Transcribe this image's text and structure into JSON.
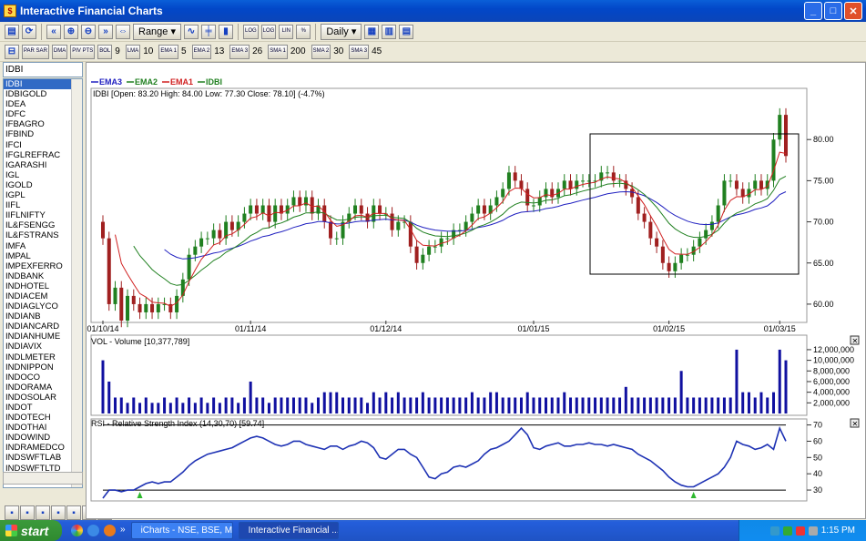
{
  "window": {
    "title": "Interactive Financial Charts",
    "min": "_",
    "max": "□",
    "close": "✕"
  },
  "toolbar1": {
    "range_label": "Range",
    "period_label": "Daily",
    "log1": "LOG",
    "log2": "LOG",
    "lin": "LIN",
    "pct": "%"
  },
  "toolbar2": {
    "par_sar": "PAR SAR",
    "dma": "DMA",
    "piv_pts": "PIV PTS",
    "bol": "BOL",
    "bol_val": "9",
    "lma": "LMA",
    "lma_val": "10",
    "ema1": "EMA 1",
    "ema1_val": "5",
    "ema2": "EMA 2",
    "ema2_val": "13",
    "ema3": "EMA 3",
    "ema3_val": "26",
    "sma1": "SMA 1",
    "sma1_val": "200",
    "sma2": "SMA 2",
    "sma2_val": "30",
    "sma3": "SMA 3",
    "sma3_val": "45"
  },
  "symbol_input": "IDBI",
  "symbols": [
    "IDBI",
    "IDBIGOLD",
    "IDEA",
    "IDFC",
    "IFBAGRO",
    "IFBIND",
    "IFCI",
    "IFGLREFRAC",
    "IGARASHI",
    "IGL",
    "IGOLD",
    "IGPL",
    "IIFL",
    "IIFLNIFTY",
    "IL&FSENGG",
    "IL&FSTRANS",
    "IMFA",
    "IMPAL",
    "IMPEXFERRO",
    "INDBANK",
    "INDHOTEL",
    "INDIACEM",
    "INDIAGLYCO",
    "INDIANB",
    "INDIANCARD",
    "INDIANHUME",
    "INDIAVIX",
    "INDLMETER",
    "INDNIPPON",
    "INDOCO",
    "INDORAMA",
    "INDOSOLAR",
    "INDOT",
    "INDOTECH",
    "INDOTHAI",
    "INDOWIND",
    "INDRAMEDCO",
    "INDSWFTLAB",
    "INDSWFTLTD"
  ],
  "selected_symbol_index": 0,
  "chart_data": [
    {
      "type": "candlestick",
      "legend": [
        "EMA3",
        "EMA2",
        "EMA1",
        "IDBI"
      ],
      "legend_colors": [
        "#2020c0",
        "#208020",
        "#d02020",
        "#208020"
      ],
      "info": "IDBI [Open: 83.20  High: 84.00  Low: 77.30  Close: 78.10] (-4.7%)",
      "x_labels": [
        "01/10/14",
        "01/11/14",
        "01/12/14",
        "01/01/15",
        "01/02/15",
        "01/03/15"
      ],
      "y_ticks": [
        "80.00",
        "75.00",
        "70.00",
        "65.00",
        "60.00"
      ],
      "ylim": [
        58,
        86
      ],
      "closes": [
        68,
        60,
        62,
        58,
        61,
        60,
        59,
        60,
        59,
        60,
        60,
        59,
        61,
        63,
        66,
        67,
        68,
        68,
        69,
        68,
        70,
        69,
        70,
        71,
        72,
        71,
        72,
        70,
        72,
        71,
        72,
        73,
        72,
        73,
        71,
        72,
        70,
        68,
        68,
        70,
        71,
        72,
        71,
        70,
        72,
        71,
        71,
        69,
        70,
        70,
        67,
        65,
        66,
        67,
        67,
        68,
        68,
        69,
        69,
        70,
        71,
        72,
        71,
        72,
        73,
        74,
        76,
        75,
        74,
        72,
        72,
        73,
        74,
        73,
        74,
        75,
        74,
        75,
        75,
        75,
        75,
        76,
        76,
        75,
        75,
        74,
        73,
        71,
        70,
        68,
        67,
        65,
        64,
        65,
        66,
        66,
        67,
        68,
        69,
        70,
        72,
        75,
        75,
        74,
        73,
        74,
        75,
        74,
        75,
        80,
        83,
        78
      ],
      "series_colors": {
        "ema1": "#d02020",
        "ema2": "#208020",
        "ema3": "#2020c0",
        "up": "#208020",
        "down": "#a02020"
      },
      "annotation": "rectangle highlight box"
    },
    {
      "type": "bar",
      "title": "VOL - Volume [10,377,789]",
      "y_ticks": [
        "12,000,000",
        "10,000,000",
        "8,000,000",
        "6,000,000",
        "4,000,000",
        "2,000,000"
      ],
      "ylim": [
        0,
        12500000
      ],
      "values": [
        10,
        6,
        3,
        3,
        2,
        3,
        2,
        3,
        2,
        2,
        3,
        2,
        3,
        2,
        3,
        2,
        3,
        2,
        3,
        2,
        3,
        3,
        2,
        3,
        6,
        3,
        3,
        2,
        3,
        3,
        3,
        3,
        3,
        3,
        2,
        3,
        4,
        4,
        4,
        3,
        3,
        3,
        3,
        2,
        4,
        3,
        4,
        3,
        4,
        3,
        3,
        3,
        4,
        3,
        3,
        3,
        3,
        3,
        3,
        3,
        4,
        3,
        3,
        4,
        4,
        3,
        3,
        3,
        3,
        4,
        3,
        3,
        3,
        3,
        3,
        4,
        3,
        3,
        3,
        3,
        3,
        3,
        3,
        3,
        3,
        5,
        3,
        3,
        3,
        3,
        3,
        3,
        3,
        3,
        8,
        3,
        3,
        3,
        3,
        3,
        3,
        3,
        3,
        12,
        4,
        4,
        3,
        4,
        3,
        4,
        12,
        10
      ],
      "value_unit_scale": 1000000,
      "color": "#1010a0"
    },
    {
      "type": "line",
      "title": "RSI - Relative Strength Index (14,30,70) [59.74]",
      "y_ticks": [
        "70",
        "60",
        "50",
        "40",
        "30"
      ],
      "ylim": [
        25,
        72
      ],
      "values": [
        25,
        30,
        30,
        29,
        30,
        30,
        32,
        34,
        35,
        34,
        35,
        35,
        38,
        41,
        45,
        48,
        50,
        52,
        53,
        54,
        55,
        56,
        58,
        60,
        62,
        63,
        62,
        60,
        58,
        57,
        58,
        60,
        60,
        58,
        57,
        56,
        55,
        57,
        57,
        55,
        57,
        58,
        60,
        59,
        56,
        50,
        49,
        52,
        55,
        55,
        52,
        50,
        44,
        38,
        37,
        40,
        41,
        44,
        45,
        44,
        46,
        48,
        52,
        55,
        56,
        58,
        60,
        64,
        68,
        64,
        56,
        55,
        57,
        58,
        59,
        57,
        57,
        58,
        58,
        59,
        58,
        58,
        57,
        58,
        57,
        56,
        55,
        52,
        50,
        48,
        45,
        42,
        38,
        35,
        33,
        32,
        32,
        34,
        36,
        38,
        40,
        44,
        50,
        60,
        58,
        57,
        55,
        56,
        58,
        55,
        68,
        60
      ],
      "ref_lines": [
        30,
        70
      ],
      "color": "#1e32b4",
      "marker_indices": [
        6,
        96
      ]
    }
  ],
  "taskbar": {
    "start": "start",
    "tasks": [
      "iCharts - NSE, BSE, M...",
      "Interactive Financial ..."
    ],
    "clock": "1:15 PM",
    "more": "»"
  }
}
